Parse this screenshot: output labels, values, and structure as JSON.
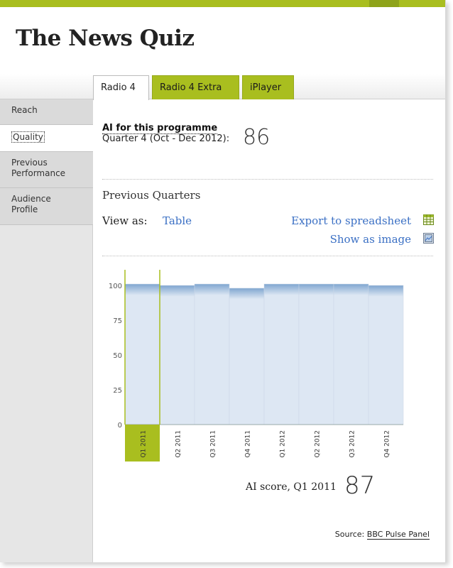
{
  "page": {
    "title": "The News Quiz"
  },
  "tabs": [
    {
      "label": "Radio 4"
    },
    {
      "label": "Radio 4 Extra"
    },
    {
      "label": "iPlayer"
    }
  ],
  "sidebar": {
    "items": [
      {
        "label": "Reach"
      },
      {
        "label": "Quality"
      },
      {
        "label": "Previous Performance"
      },
      {
        "label": "Audience Profile"
      }
    ]
  },
  "ai": {
    "label": "AI for this programme",
    "quarter": "Quarter 4 (Oct - Dec 2012):",
    "score": "86"
  },
  "previous": {
    "heading": "Previous Quarters",
    "view_as": "View as:",
    "table_link": "Table",
    "export_link": "Export to spreadsheet",
    "image_link": "Show as image",
    "selected_label": "AI score, Q1 2011",
    "selected_score": "87"
  },
  "source": {
    "prefix": "Source:",
    "link": "BBC Pulse Panel"
  },
  "colors": {
    "accent": "#a9be1f",
    "link": "#3a6fc4",
    "bar_top": "#7fa6d0",
    "bar_fill": "#dde7f3"
  },
  "chart_data": {
    "type": "bar",
    "categories": [
      "Q1 2011",
      "Q2 2011",
      "Q3 2011",
      "Q4 2011",
      "Q1 2012",
      "Q2 2012",
      "Q3 2012",
      "Q4 2012"
    ],
    "values": [
      101,
      100,
      101,
      98,
      101,
      101,
      101,
      100
    ],
    "yticks": [
      0,
      25,
      50,
      75,
      100
    ],
    "ylim": [
      0,
      100
    ],
    "selected_index": 0
  }
}
